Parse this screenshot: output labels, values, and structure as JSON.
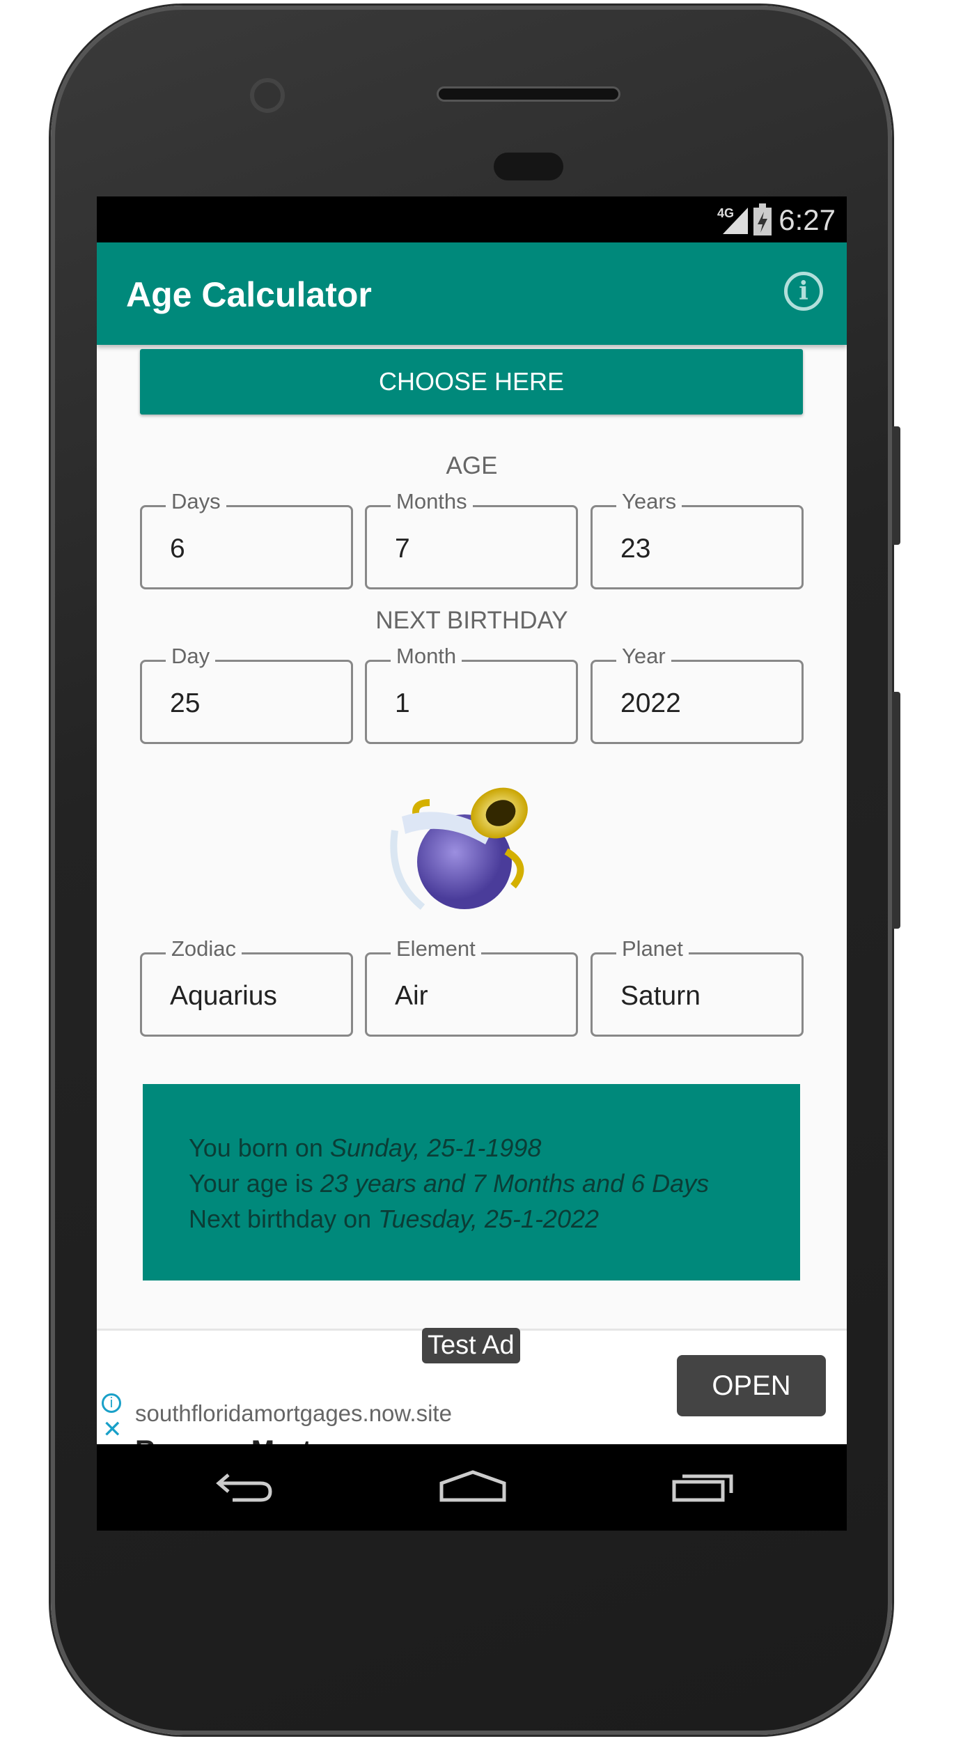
{
  "status_bar": {
    "network": "4G",
    "time": "6:27"
  },
  "app_bar": {
    "title": "Age Calculator",
    "info_icon": "info-icon"
  },
  "choose_button": "CHOOSE HERE",
  "age": {
    "heading": "AGE",
    "fields": [
      {
        "label": "Days",
        "value": "6"
      },
      {
        "label": "Months",
        "value": "7"
      },
      {
        "label": "Years",
        "value": "23"
      }
    ]
  },
  "next_birthday": {
    "heading": "NEXT BIRTHDAY",
    "fields": [
      {
        "label": "Day",
        "value": "25"
      },
      {
        "label": "Month",
        "value": "1"
      },
      {
        "label": "Year",
        "value": "2022"
      }
    ]
  },
  "zodiac_image": "aquarius-water-jar-icon",
  "zodiac": {
    "fields": [
      {
        "label": "Zodiac",
        "value": "Aquarius"
      },
      {
        "label": "Element",
        "value": "Air"
      },
      {
        "label": "Planet",
        "value": "Saturn"
      }
    ]
  },
  "result": {
    "line1_prefix": "You born on ",
    "line1_value": "Sunday, 25-1-1998",
    "line2_prefix": "Your age is ",
    "line2_value": "23 years and 7 Months and 6 Days",
    "line3_prefix": "Next birthday on ",
    "line3_value": "Tuesday, 25-1-2022"
  },
  "ad": {
    "badge": "Test Ad",
    "open": "OPEN",
    "url": "southfloridamortgages.now.site",
    "title": "Reverse Mort"
  },
  "colors": {
    "primary": "#00897b",
    "status_bar": "#000000",
    "ad_link": "#19a0c8"
  }
}
